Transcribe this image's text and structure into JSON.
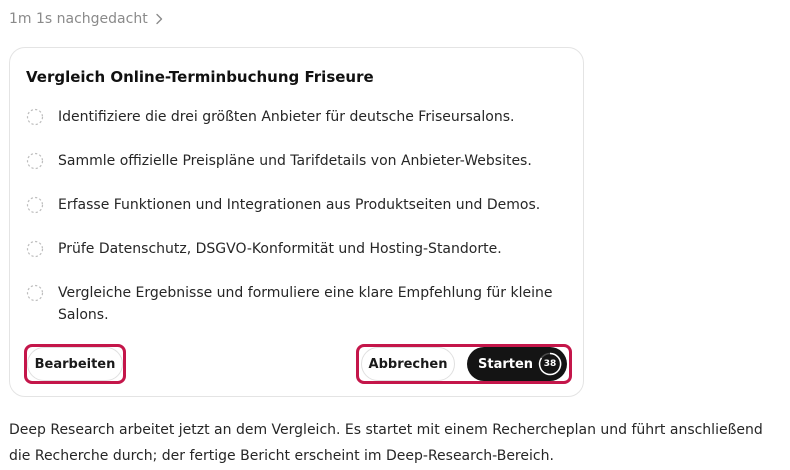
{
  "thought": {
    "label": "1m 1s nachgedacht",
    "icon": "chevron-right-icon"
  },
  "plan": {
    "title": "Vergleich Online-Terminbuchung Friseure",
    "steps": [
      "Identifiziere die drei größten Anbieter für deutsche Friseursalons.",
      "Sammle offizielle Preispläne und Tarifdetails von Anbieter-Websites.",
      "Erfasse Funktionen und Integrationen aus Produktseiten und Demos.",
      "Prüfe Datenschutz, DSGVO-Konformität und Hosting-Standorte.",
      "Vergleiche Ergebnisse und formuliere eine klare Empfehlung für kleine Salons."
    ],
    "step_icon": "pending-circle-icon"
  },
  "actions": {
    "edit_label": "Bearbeiten",
    "cancel_label": "Abbrechen",
    "start_label": "Starten",
    "countdown": "38",
    "highlight_color": "#c4164a",
    "start_bg": "#141414"
  },
  "message": {
    "text": "Deep Research arbeitet jetzt an dem Vergleich. Es startet mit einem Rechercheplan und führt anschließend die Recherche durch; der fertige Bericht erscheint im Deep-Research-Bereich."
  }
}
